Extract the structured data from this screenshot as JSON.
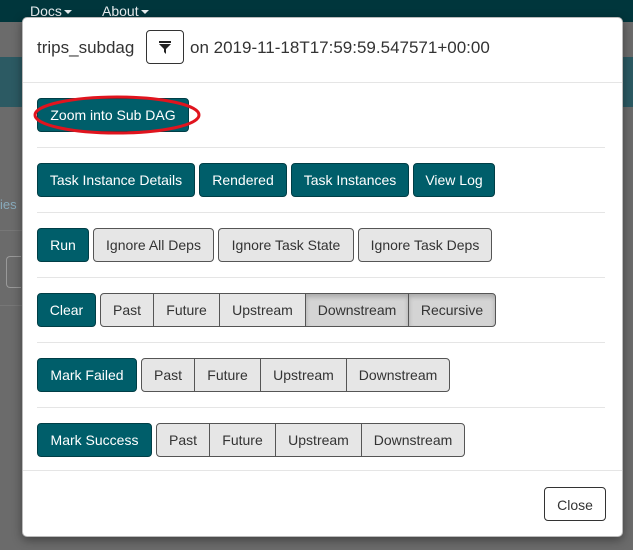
{
  "nav": {
    "docs_label": "Docs",
    "about_label": "About"
  },
  "background": {
    "fragment_text": "ies"
  },
  "modal": {
    "dag_name": "trips_subdag",
    "on_label": "on 2019-11-18T17:59:59.547571+00:00",
    "zoom_button": "Zoom into Sub DAG",
    "info_buttons": [
      "Task Instance Details",
      "Rendered",
      "Task Instances",
      "View Log"
    ],
    "run": {
      "run_button": "Run",
      "options": [
        "Ignore All Deps",
        "Ignore Task State",
        "Ignore Task Deps"
      ]
    },
    "clear": {
      "button": "Clear",
      "options": [
        "Past",
        "Future",
        "Upstream",
        "Downstream",
        "Recursive"
      ],
      "active": [
        "Downstream",
        "Recursive"
      ]
    },
    "mark_failed": {
      "button": "Mark Failed",
      "options": [
        "Past",
        "Future",
        "Upstream",
        "Downstream"
      ]
    },
    "mark_success": {
      "button": "Mark Success",
      "options": [
        "Past",
        "Future",
        "Upstream",
        "Downstream"
      ]
    },
    "close_button": "Close"
  },
  "colors": {
    "primary": "#005e6a",
    "navbar": "#00363c",
    "annotation": "#e0141e"
  },
  "icons": {
    "filter": "filter-icon"
  }
}
